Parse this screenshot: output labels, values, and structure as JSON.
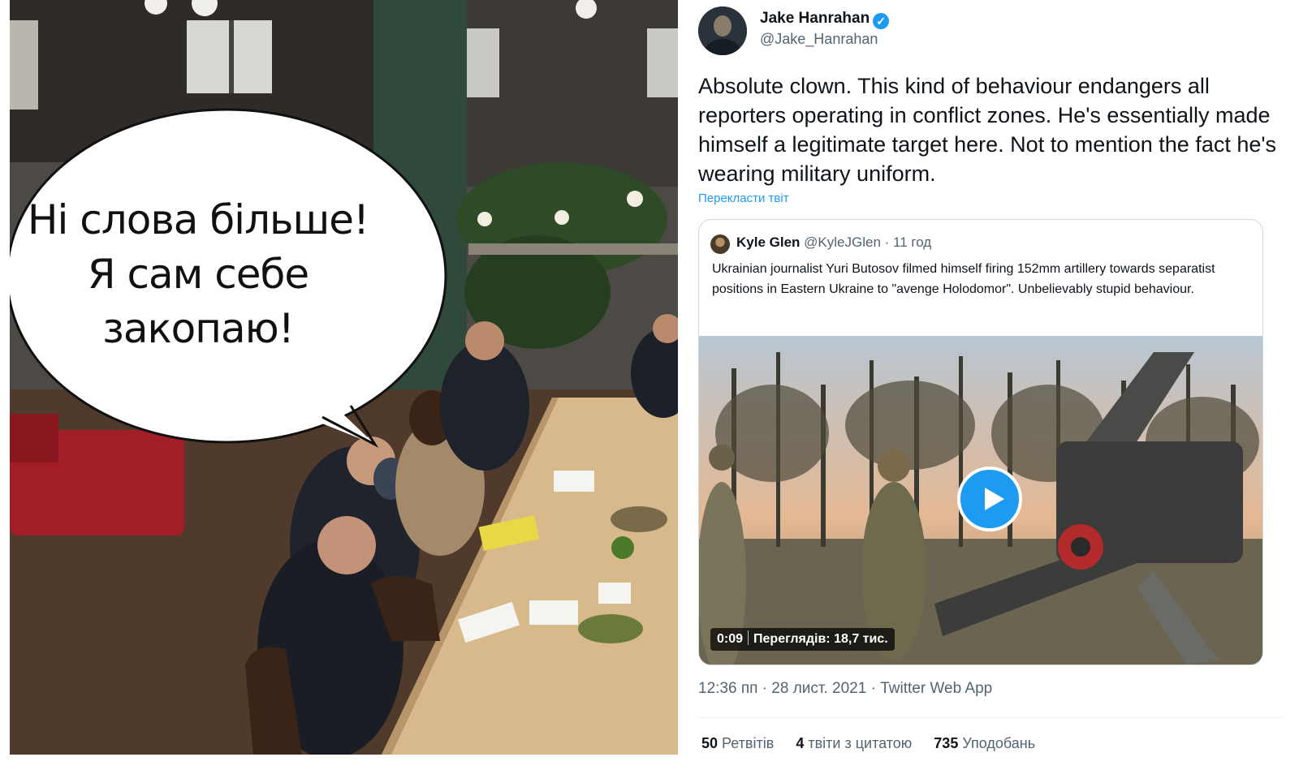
{
  "meme": {
    "bubble_lines": [
      "Ні слова більше!",
      "Я сам себе",
      "закопаю!"
    ]
  },
  "tweet": {
    "author_name": "Jake Hanrahan",
    "author_handle": "@Jake_Hanrahan",
    "verified_icon": "✓",
    "text": "Absolute clown. This kind of behaviour endangers all reporters operating in conflict zones. He's essentially made himself a legitimate target here. Not to mention the fact he's wearing military uniform.",
    "translate_label": "Перекласти твіт",
    "quote": {
      "name": "Kyle Glen",
      "handle": "@KyleJGlen",
      "time": "· 11 год",
      "text": "Ukrainian journalist Yuri Butosov filmed himself firing 152mm artillery towards separatist positions in Eastern Ukraine to \"avenge Holodomor\". Unbelievably stupid behaviour.",
      "video_duration": "0:09",
      "video_views": "Переглядів: 18,7 тис."
    },
    "meta": "12:36 пп · 28 лист. 2021 · Twitter Web App",
    "stats": {
      "retweets_count": "50",
      "retweets_label": "Ретвітів",
      "quotes_count": "4",
      "quotes_label": "твіти з цитатою",
      "likes_count": "735",
      "likes_label": "Уподобань"
    }
  },
  "colors": {
    "accent": "#1d9bf0",
    "text": "#0f1419",
    "muted": "#536471"
  }
}
